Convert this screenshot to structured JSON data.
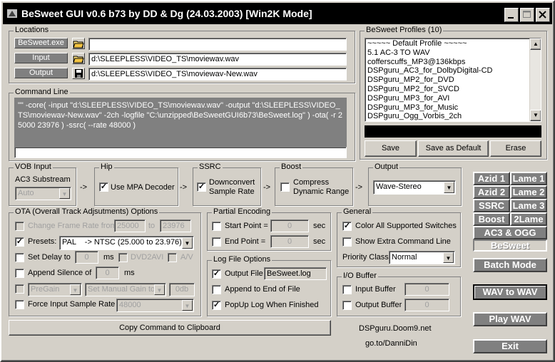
{
  "window": {
    "title": "BeSweet GUI v0.6 b73 by DD & Dg (24.03.2003)  [Win2K Mode]"
  },
  "locations": {
    "label": "Locations",
    "exe_label": "BeSweet.exe",
    "exe_value": "",
    "input_label": "Input",
    "input_value": "d:\\SLEEPLESS\\VIDEO_TS\\moviewav.wav",
    "output_label": "Output",
    "output_value": "d:\\SLEEPLESS\\VIDEO_TS\\moviewav-New.wav"
  },
  "profiles": {
    "label": "BeSweet Profiles (10)",
    "items": [
      "~~~~~ Default Profile ~~~~~",
      "5.1 AC-3 TO WAV",
      "cofferscuffs_MP3@136kbps",
      "DSPguru_AC3_for_DolbyDigital-CD",
      "DSPguru_MP2_for_DVD",
      "DSPguru_MP2_for_SVCD",
      "DSPguru_MP3_for_AVI",
      "DSPguru_MP3_for_Music",
      "DSPguru_Ogg_Vorbis_2ch"
    ],
    "save": "Save",
    "save_default": "Save as Default",
    "erase": "Erase"
  },
  "cmdline": {
    "label": "Command Line",
    "text": "\"\" -core( -input \"d:\\SLEEPLESS\\VIDEO_TS\\moviewav.wav\" -output \"d:\\SLEEPLESS\\VIDEO_TS\\moviewav-New.wav\" -2ch -logfile \"C:\\unzipped\\BeSweetGUI6b73\\BeSweet.log\" ) -ota( -r 25000 23976 ) -ssrc( --rate 48000 )"
  },
  "vob": {
    "label": "VOB Input",
    "substream_label": "AC3 Substream",
    "substream_value": "Auto"
  },
  "hip": {
    "label": "Hip",
    "use_mpa": "Use MPA Decoder"
  },
  "ssrc": {
    "label": "SSRC",
    "downconvert": "Downconvert Sample Rate",
    "downconvert_l1": "Downconvert",
    "downconvert_l2": "Sample Rate"
  },
  "boost": {
    "label": "Boost",
    "compress_l1": "Compress",
    "compress_l2": "Dynamic Range"
  },
  "output": {
    "label": "Output",
    "value": "Wave-Stereo"
  },
  "arrow": "->",
  "ota": {
    "label": "OTA (Overall Track Adjsutments) Options",
    "change_fr": "Change Frame Rate from",
    "fr_from": "25000",
    "fr_to_label": "to",
    "fr_to": "23976",
    "presets": "Presets:",
    "preset_value": "PAL    -> NTSC (25.000 to 23.976)",
    "set_delay": "Set Delay to",
    "delay_value": "0",
    "ms": "ms",
    "dvd2avi": "DVD2AVI",
    "av": "A/V",
    "append_silence": "Append Silence of",
    "silence_value": "0",
    "pregain": "PreGain",
    "manual_gain": "Set Manual Gain to",
    "gain_value": "0db",
    "force_rate": "Force Input Sample Rate",
    "force_value": "48000"
  },
  "partial": {
    "label": "Partial Encoding",
    "start": "Start Point =",
    "start_value": "0",
    "end": "End Point =",
    "end_value": "0",
    "sec": "sec"
  },
  "logopts": {
    "label": "Log File Options",
    "output_file": "Output File",
    "log_name": "BeSweet.log",
    "append": "Append to End of File",
    "popup": "PopUp Log When Finished"
  },
  "general": {
    "label": "General",
    "color": "Color All Supported Switches",
    "extra": "Show Extra Command Line",
    "priority_label": "Priority Class",
    "priority_value": "Normal"
  },
  "io": {
    "label": "I/O Buffer",
    "input": "Input Buffer",
    "input_value": "0",
    "output": "Output Buffer",
    "output_value": "0"
  },
  "copy_button": "Copy Command to Clipboard",
  "links": {
    "doom9": "DSPguru.Doom9.net",
    "danni": "go.to/DanniDin"
  },
  "tabs": {
    "azid1": "Azid 1",
    "lame1": "Lame 1",
    "azid2": "Azid 2",
    "lame2": "Lame 2",
    "ssrc": "SSRC",
    "lame3": "Lame 3",
    "boost": "Boost",
    "lame2b": "2Lame",
    "ac3ogg": "AC3 & OGG",
    "besweet": "BeSweet"
  },
  "actions": {
    "batch": "Batch Mode",
    "wav2wav": "WAV to WAV",
    "play": "Play WAV",
    "exit": "Exit"
  },
  "check": "✓"
}
